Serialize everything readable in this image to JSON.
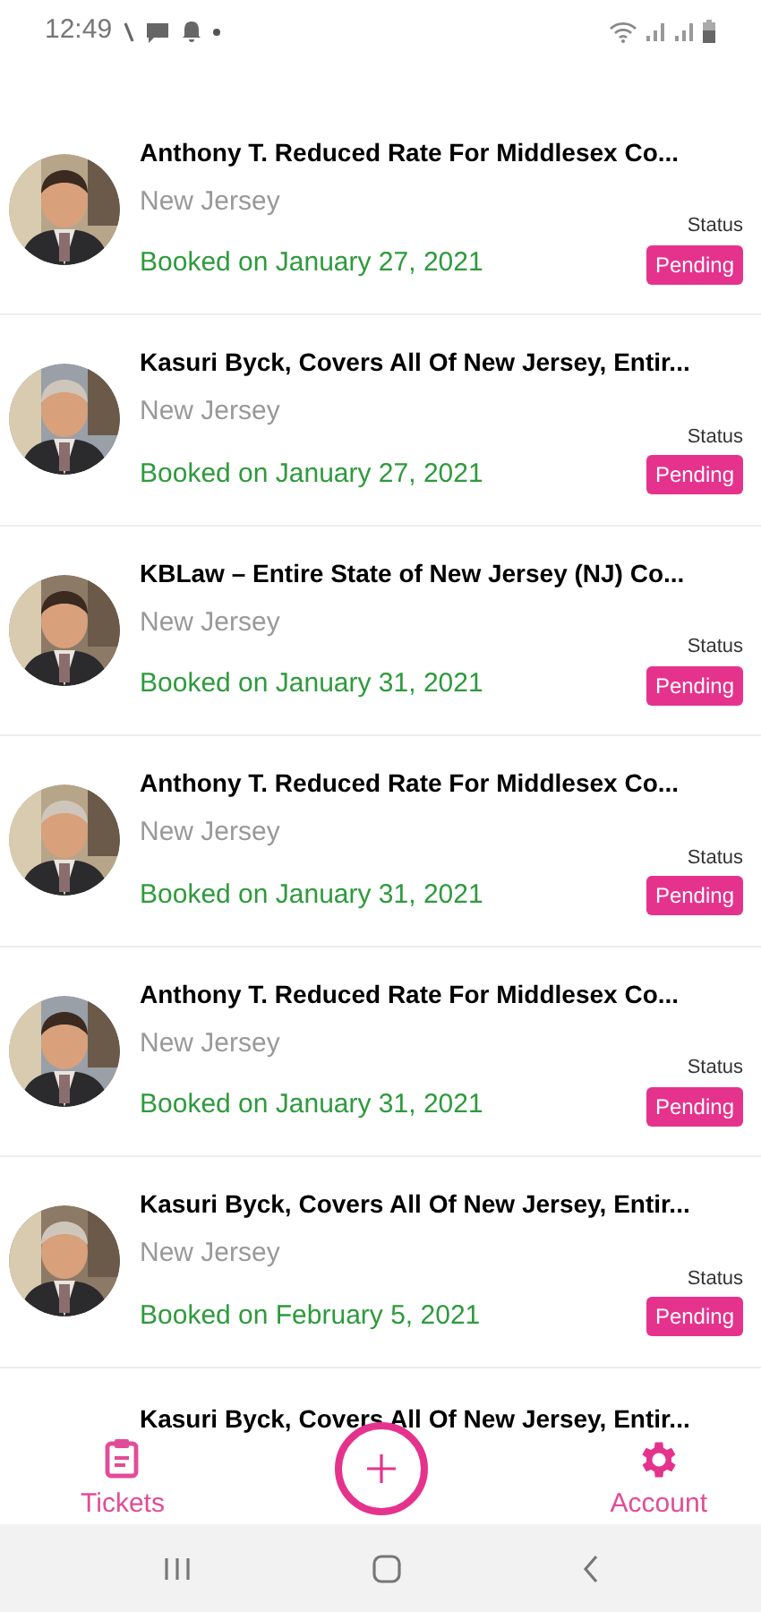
{
  "status_bar": {
    "time": "12:49"
  },
  "tickets": [
    {
      "title": "Anthony T. Reduced Rate For Middlesex Co...",
      "location": "New Jersey",
      "booked": "Booked on January 27, 2021",
      "status_label": "Status",
      "status": "Pending"
    },
    {
      "title": "Kasuri Byck, Covers All Of New Jersey, Entir...",
      "location": "New Jersey",
      "booked": "Booked on January 27, 2021",
      "status_label": "Status",
      "status": "Pending"
    },
    {
      "title": "KBLaw – Entire State of New Jersey (NJ) Co...",
      "location": "New Jersey",
      "booked": "Booked on January 31, 2021",
      "status_label": "Status",
      "status": "Pending"
    },
    {
      "title": "Anthony T. Reduced Rate For Middlesex Co...",
      "location": "New Jersey",
      "booked": "Booked on January 31, 2021",
      "status_label": "Status",
      "status": "Pending"
    },
    {
      "title": "Anthony T. Reduced Rate For Middlesex Co...",
      "location": "New Jersey",
      "booked": "Booked on January 31, 2021",
      "status_label": "Status",
      "status": "Pending"
    },
    {
      "title": "Kasuri Byck, Covers All Of New Jersey, Entir...",
      "location": "New Jersey",
      "booked": "Booked on February 5, 2021",
      "status_label": "Status",
      "status": "Pending"
    }
  ],
  "partial_ticket": {
    "title": "Kasuri Byck, Covers All Of New Jersey, Entir..."
  },
  "nav": [
    {
      "label": "Tickets",
      "kind": "tickets"
    },
    {
      "kind": "add"
    },
    {
      "label": "Account",
      "kind": "account"
    }
  ]
}
